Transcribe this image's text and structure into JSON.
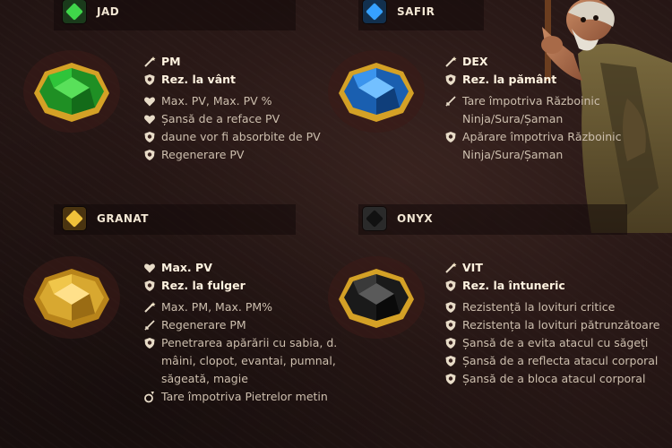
{
  "gems": [
    {
      "name": "JAD",
      "color": "#2fbf3a",
      "primary": [
        {
          "icon": "wand-icon",
          "text": "PM"
        },
        {
          "icon": "shield-icon",
          "text": "Rez. la vânt"
        }
      ],
      "secondary": [
        {
          "icon": "heart-icon",
          "text": "Max. PV, Max. PV %"
        },
        {
          "icon": "heart-icon",
          "text": "Șansă de a reface PV"
        },
        {
          "icon": "shield-icon",
          "text": "daune vor fi absorbite de PV"
        },
        {
          "icon": "shield-icon",
          "text": "Regenerare PV"
        }
      ]
    },
    {
      "name": "SAFIR",
      "color": "#2a8ee8",
      "primary": [
        {
          "icon": "wand-icon",
          "text": "DEX"
        },
        {
          "icon": "shield-icon",
          "text": "Rez. la pământ"
        }
      ],
      "secondary": [
        {
          "icon": "sword-icon",
          "text": "Tare împotriva Războinic Ninja/Sura/Șaman"
        },
        {
          "icon": "shield-icon",
          "text": "Apărare împotriva Războinic Ninja/Sura/Șaman"
        }
      ]
    },
    {
      "name": "GRANAT",
      "color": "#e3b22a",
      "primary": [
        {
          "icon": "heart-icon",
          "text": "Max. PV"
        },
        {
          "icon": "shield-icon",
          "text": "Rez. la fulger"
        }
      ],
      "secondary": [
        {
          "icon": "wand-icon",
          "text": "Max. PM, Max. PM%"
        },
        {
          "icon": "sword-icon",
          "text": "Regenerare PM"
        },
        {
          "icon": "shield-icon",
          "text": "Penetrarea apărării cu sabia, d. mâini, clopot, evantai, pumnal, săgeată, magie"
        },
        {
          "icon": "ring-icon",
          "text": "Tare împotriva Pietrelor metin"
        }
      ]
    },
    {
      "name": "ONYX",
      "color": "#2b2b2b",
      "primary": [
        {
          "icon": "wand-icon",
          "text": "VIT"
        },
        {
          "icon": "shield-icon",
          "text": "Rez. la întuneric"
        }
      ],
      "secondary": [
        {
          "icon": "shield-icon",
          "text": "Rezistență la lovituri critice"
        },
        {
          "icon": "shield-icon",
          "text": "Rezistența la lovituri pătrunzătoare"
        },
        {
          "icon": "shield-icon",
          "text": "Șansă de a evita atacul cu săgeți"
        },
        {
          "icon": "shield-icon",
          "text": "Șansă de a reflecta atacul corporal"
        },
        {
          "icon": "shield-icon",
          "text": "Șansă de a bloca atacul corporal"
        }
      ]
    }
  ]
}
